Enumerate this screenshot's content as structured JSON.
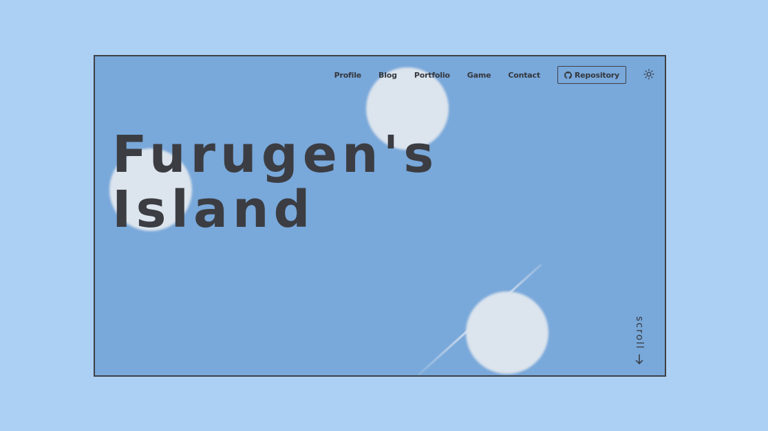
{
  "nav": {
    "items": [
      {
        "label": "Profile"
      },
      {
        "label": "Blog"
      },
      {
        "label": "Portfolio"
      },
      {
        "label": "Game"
      },
      {
        "label": "Contact"
      }
    ],
    "repository_label": "Repository",
    "repository_icon": "github-icon",
    "theme_icon": "sun-icon"
  },
  "hero": {
    "title_line1": "Furugen's",
    "title_line2": "Island"
  },
  "scroll": {
    "label": "scroll",
    "icon": "arrow-down-icon"
  },
  "colors": {
    "page_background": "#abd0f3",
    "hero_background": "#79a8da",
    "text": "#3b3d42",
    "bubble": "#dce4ed"
  }
}
